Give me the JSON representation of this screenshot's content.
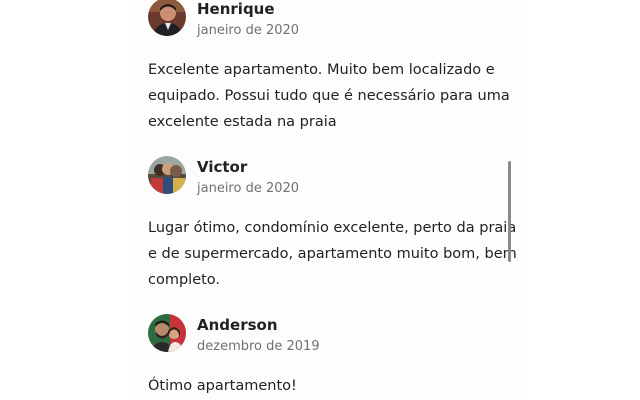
{
  "reviews": [
    {
      "name": "Henrique",
      "date": "janeiro de 2020",
      "text": "Excelente apartamento. Muito bem localizado e equipado. Possui tudo que é necessário para uma excelente estada na praia"
    },
    {
      "name": "Victor",
      "date": "janeiro de 2020",
      "text": "Lugar ótimo, condomínio excelente, perto da praia e de supermercado, apartamento muito bom, bem completo."
    },
    {
      "name": "Anderson",
      "date": "dezembro de 2019",
      "text": "Ótimo apartamento!"
    }
  ],
  "colors": {
    "text": "#222222",
    "secondary_text": "#717171",
    "scrollbar": "#8a8a8a"
  }
}
